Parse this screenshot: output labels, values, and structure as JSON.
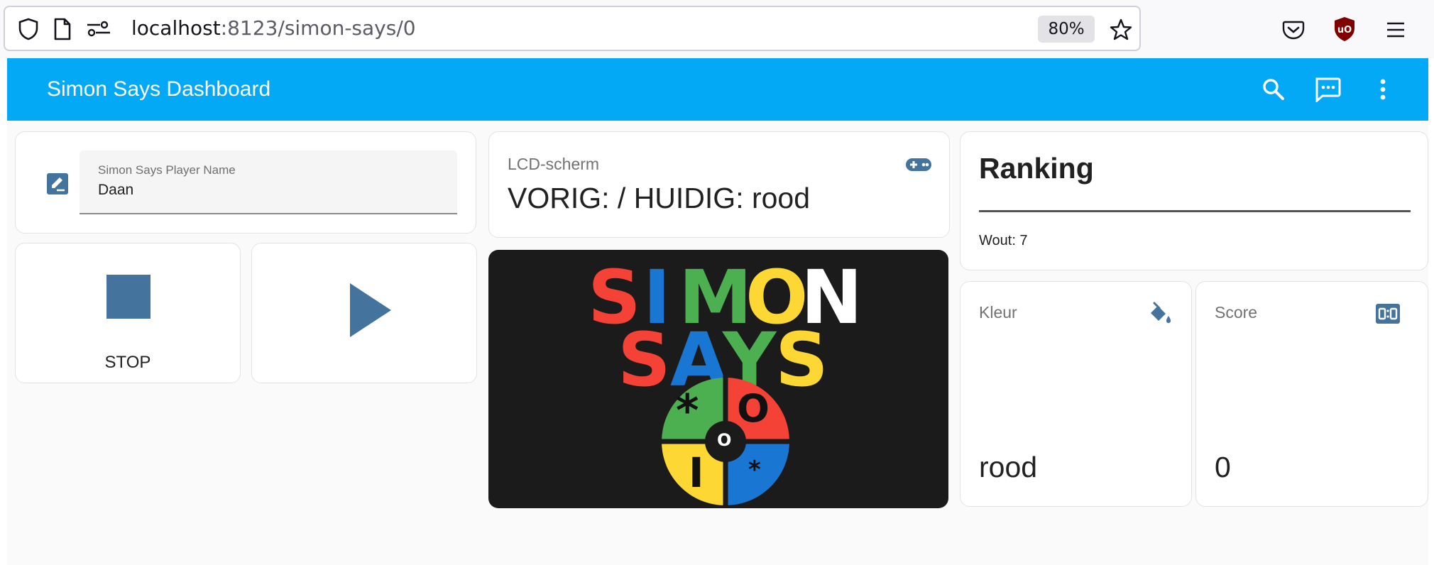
{
  "browser": {
    "url_host": "localhost",
    "url_path": ":8123/simon-says/0",
    "zoom": "80%"
  },
  "header": {
    "title": "Simon Says Dashboard",
    "icons": [
      "search-icon",
      "assist-chat-icon",
      "more-vert-icon"
    ]
  },
  "player_card": {
    "label": "Simon Says Player Name",
    "value": "Daan",
    "icon": "form-textbox-icon"
  },
  "stop_button": {
    "label": "STOP",
    "icon": "stop-icon"
  },
  "play_button": {
    "icon": "play-icon"
  },
  "lcd_card": {
    "title": "LCD-scherm",
    "value": "VORIG: / HUIDIG: rood",
    "icon": "gamepad-icon"
  },
  "logo": {
    "row1": [
      "S",
      "I",
      "M",
      "O",
      "N"
    ],
    "row2": [
      "S",
      "A",
      "Y",
      "S"
    ],
    "button_symbols": [
      "*",
      "O",
      "I",
      "*"
    ],
    "center_symbol": "O"
  },
  "ranking_card": {
    "title": "Ranking",
    "entries": [
      "Wout: 7"
    ]
  },
  "kleur_card": {
    "title": "Kleur",
    "value": "rood",
    "icon": "format-color-fill-icon"
  },
  "score_card": {
    "title": "Score",
    "value": "0",
    "icon": "scoreboard-icon"
  },
  "colors": {
    "header": "#03a9f4",
    "icon": "#44739e",
    "red": "#f44336",
    "blue": "#1976d2",
    "green": "#4caf50",
    "yellow": "#fdd835",
    "white": "#ffffff"
  }
}
